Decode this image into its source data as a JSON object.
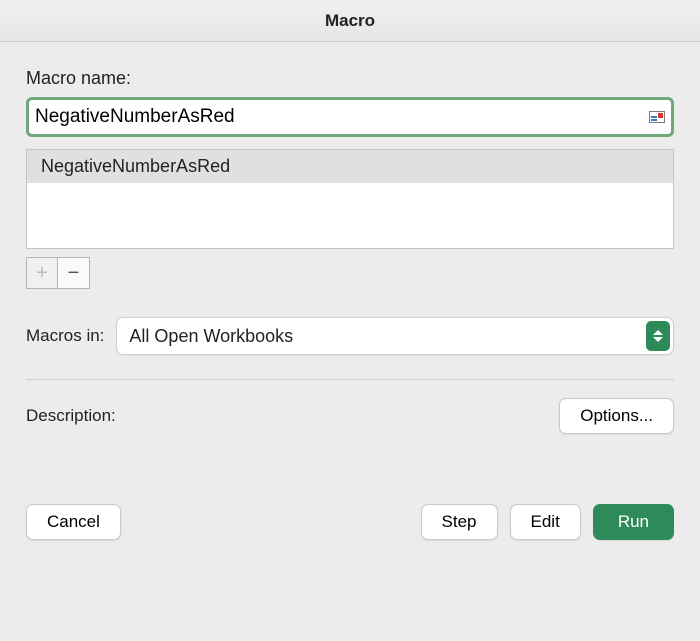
{
  "title": "Macro",
  "labels": {
    "macro_name": "Macro name:",
    "macros_in": "Macros in:",
    "description": "Description:"
  },
  "macro_name_input": {
    "value": "NegativeNumberAsRed"
  },
  "macro_list": {
    "items": [
      "NegativeNumberAsRed"
    ],
    "selected_index": 0
  },
  "controls": {
    "add_label": "+",
    "remove_label": "−",
    "add_disabled": true,
    "remove_disabled": false
  },
  "macros_in_select": {
    "value": "All Open Workbooks"
  },
  "buttons": {
    "options": "Options...",
    "cancel": "Cancel",
    "step": "Step",
    "edit": "Edit",
    "run": "Run"
  }
}
